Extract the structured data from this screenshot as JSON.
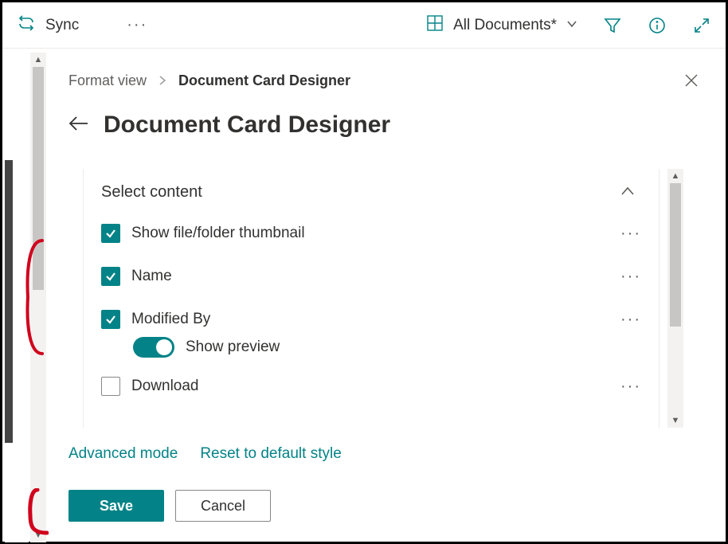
{
  "toolbar": {
    "sync_label": "Sync",
    "view_label": "All Documents*"
  },
  "panel": {
    "breadcrumb_root": "Format view",
    "breadcrumb_current": "Document Card Designer",
    "title": "Document Card Designer",
    "section_title": "Select content",
    "rows": [
      {
        "label": "Show file/folder thumbnail",
        "checked": true,
        "more": true
      },
      {
        "label": "Name",
        "checked": true,
        "more": true
      },
      {
        "label": "Modified By",
        "checked": true,
        "more": true,
        "toggle_label": "Show preview",
        "toggle_on": true
      },
      {
        "label": "Download",
        "checked": false,
        "more": true
      }
    ],
    "advanced_link": "Advanced mode",
    "reset_link": "Reset to default style",
    "save_label": "Save",
    "cancel_label": "Cancel"
  }
}
